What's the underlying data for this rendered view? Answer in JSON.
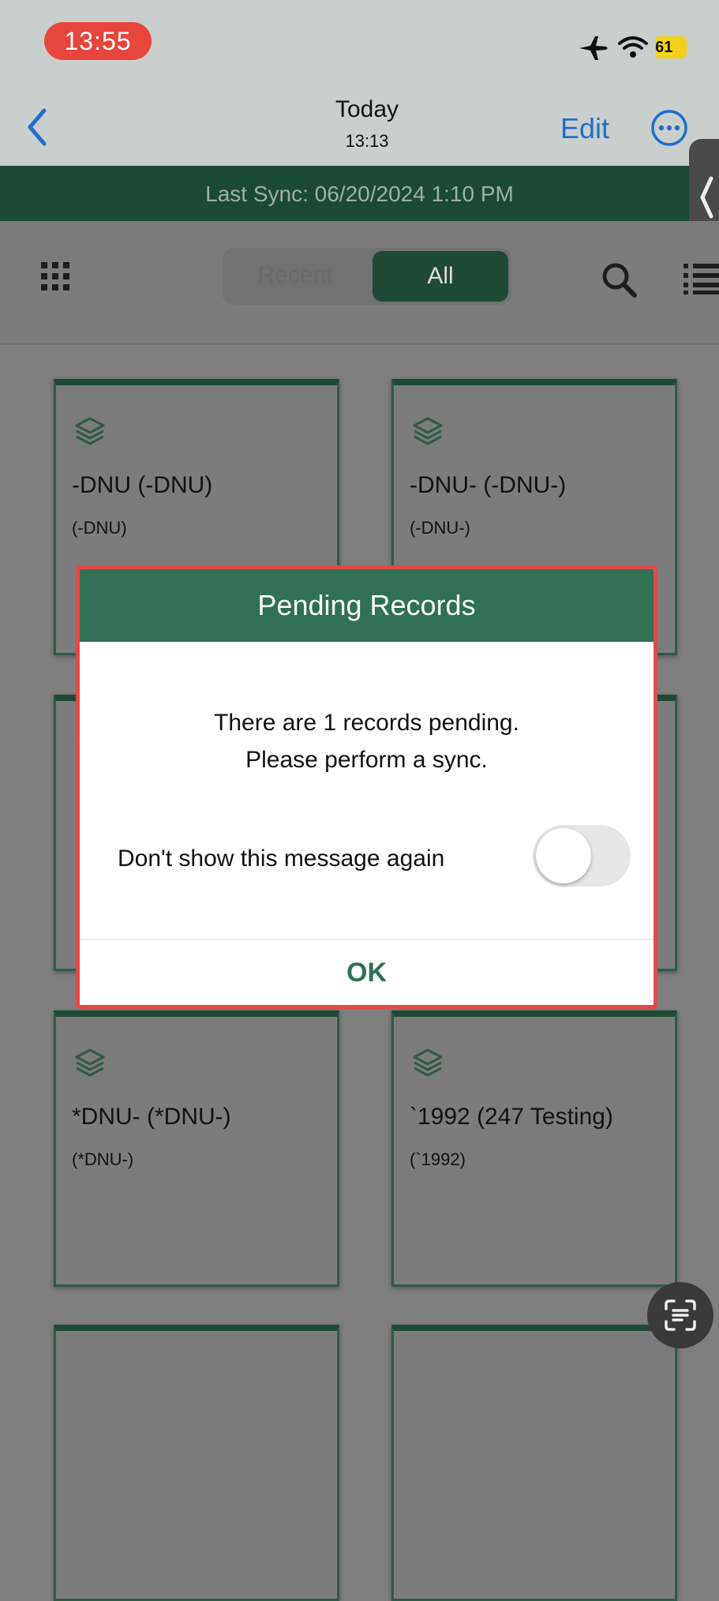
{
  "status_bar": {
    "time": "13:55",
    "battery": "61"
  },
  "nav": {
    "title": "Today",
    "subtitle": "13:13",
    "edit_label": "Edit"
  },
  "sync": {
    "text": "Last Sync: 06/20/2024 1:10 PM"
  },
  "toolbar": {
    "segment_recent": "Recent",
    "segment_all": "All",
    "selected": "All"
  },
  "cards": [
    {
      "title": "-DNU (-DNU)",
      "subtitle": "(-DNU)"
    },
    {
      "title": "-DNU- (-DNU-)",
      "subtitle": "(-DNU-)"
    },
    {
      "title": "",
      "subtitle": ""
    },
    {
      "title": "",
      "subtitle": ""
    },
    {
      "title": "*DNU- (*DNU-)",
      "subtitle": "(*DNU-)"
    },
    {
      "title": "`1992 (247 Testing)",
      "subtitle": "(`1992)"
    }
  ],
  "dialog": {
    "title": "Pending Records",
    "message_line1": "There are 1 records pending.",
    "message_line2": "Please perform a sync.",
    "toggle_label": "Don't show this message again",
    "toggle_on": false,
    "ok_label": "OK"
  },
  "colors": {
    "brand_green": "#2f7152",
    "dialog_outline": "#e24a4a",
    "link_blue": "#1f6fcf"
  }
}
